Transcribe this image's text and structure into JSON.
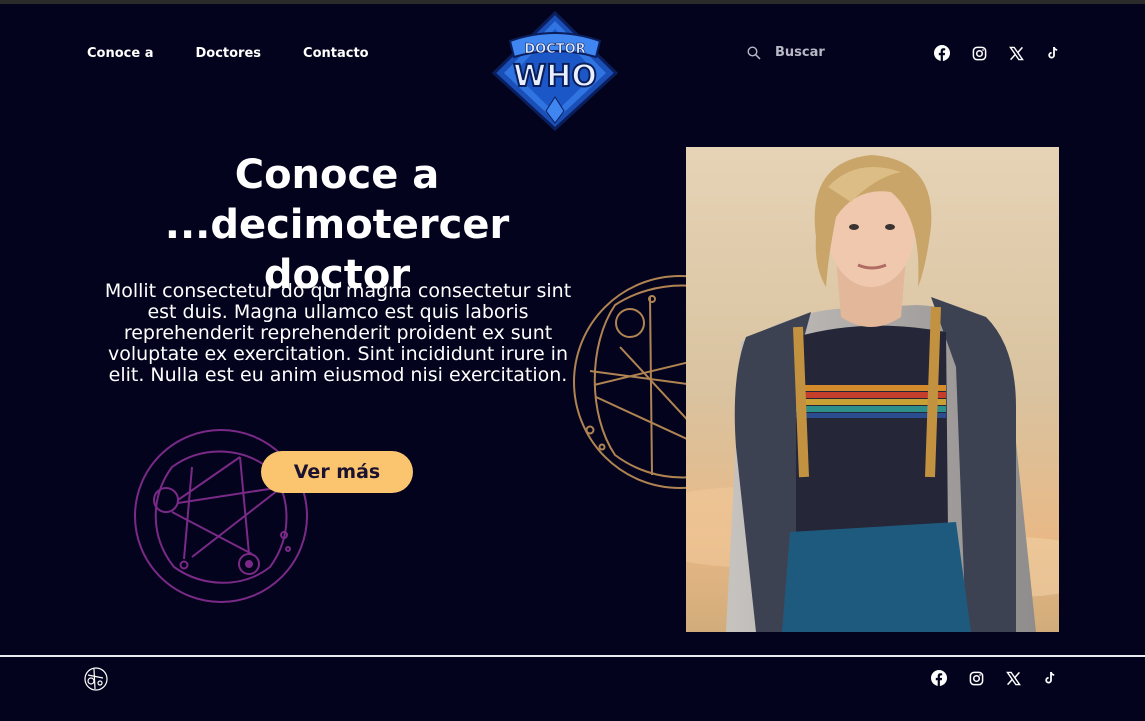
{
  "header": {
    "nav": [
      {
        "label": "Conoce a"
      },
      {
        "label": "Doctores"
      },
      {
        "label": "Contacto"
      }
    ],
    "logo": {
      "line1": "DOCTOR",
      "line2": "WHO"
    },
    "search": {
      "placeholder": "Buscar",
      "icon": "search-icon"
    },
    "socials": [
      "facebook-icon",
      "instagram-icon",
      "x-icon",
      "tiktok-icon"
    ]
  },
  "hero": {
    "title": "Conoce a ...decimotercer doctor",
    "body": "Mollit consectetur do qui magna consectetur sint est duis. Magna ullamco est quis laboris reprehenderit reprehenderit proident ex sunt voluptate ex exercitation. Sint incididunt irure in elit. Nulla est eu anim eiusmod nisi exercitation.",
    "cta_label": "Ver más"
  },
  "footer": {
    "logo_icon": "gallifreyan-icon",
    "socials": [
      "facebook-icon",
      "instagram-icon",
      "x-icon",
      "tiktok-icon"
    ]
  },
  "colors": {
    "background": "#03031d",
    "cta": "#fbc56f",
    "glyph_purple": "#7a2a86",
    "glyph_gold": "#b08452"
  }
}
